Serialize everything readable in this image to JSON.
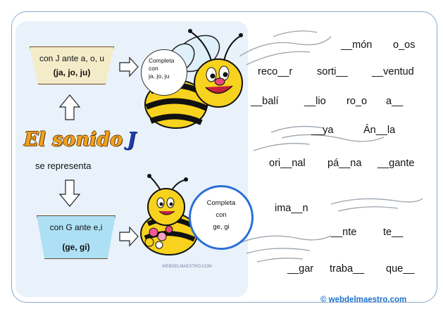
{
  "rule_g": {
    "line1": "con G ante e,i",
    "line2": "(ge, gi)"
  },
  "rule_j": {
    "line1": "con J ante a, o, u",
    "line2": "(ja, jo, ju)"
  },
  "title": {
    "text": "El sonido",
    "letter": "J"
  },
  "subtitle": "se representa",
  "bubble_j": {
    "l1": "Completa",
    "l2": "con",
    "l3": "ja, jo, ju"
  },
  "bubble_g": {
    "l1": "Completa",
    "l2": "con",
    "l3": "ge, gi"
  },
  "exercises": [
    "__món",
    "o_os",
    "reco__r",
    "sorti__",
    "__ventud",
    "__balí",
    "__lio",
    "ro_o",
    "a__",
    "__ya",
    "Án__la",
    "ori__nal",
    "pá__na",
    "__gante",
    "ima__n",
    "__nte",
    "te__",
    "__gar",
    "traba__",
    "que__"
  ],
  "watermark": "WEBDELMAESTRO.COM",
  "footer": "© webdelmaestro.com",
  "colors": {
    "title": "#f3a21f",
    "letter": "#1f3ea8",
    "box_j": "#f4ecc8",
    "box_g": "#aee0f5",
    "footer": "#1e72c8"
  }
}
